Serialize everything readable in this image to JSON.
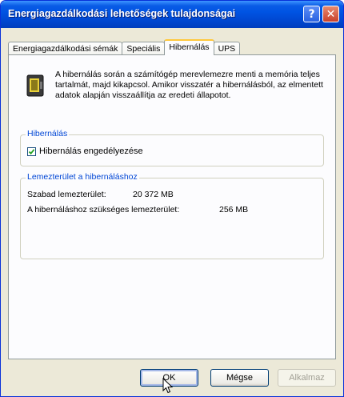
{
  "window": {
    "title": "Energiagazdálkodási lehetőségek tulajdonságai",
    "help_glyph": "?",
    "close_glyph": "✕"
  },
  "tabs": [
    {
      "label": "Energiagazdálkodási sémák",
      "active": false
    },
    {
      "label": "Speciális",
      "active": false
    },
    {
      "label": "Hibernálás",
      "active": true
    },
    {
      "label": "UPS",
      "active": false
    }
  ],
  "intro": {
    "icon": "battery-icon",
    "text": "A hibernálás során a számítógép merevlemezre menti a memória teljes tartalmát, majd kikapcsol. Amikor visszatér a hibernálásból, az elmentett adatok alapján visszaállítja az eredeti állapotot."
  },
  "hibernate_group": {
    "label": "Hibernálás",
    "checkbox_label": "Hibernálás engedélyezése",
    "checked": true
  },
  "disk_group": {
    "label": "Lemezterület a hibernáláshoz",
    "free_label": "Szabad lemezterület:",
    "free_value": "20 372 MB",
    "required_label": "A hibernáláshoz szükséges lemezterület:",
    "required_value": "256 MB"
  },
  "buttons": {
    "ok": "OK",
    "cancel": "Mégse",
    "apply": "Alkalmaz"
  },
  "colors": {
    "titlebar": "#0054e3",
    "group_label": "#0046d5",
    "active_tab_accent": "#ffc83c"
  }
}
